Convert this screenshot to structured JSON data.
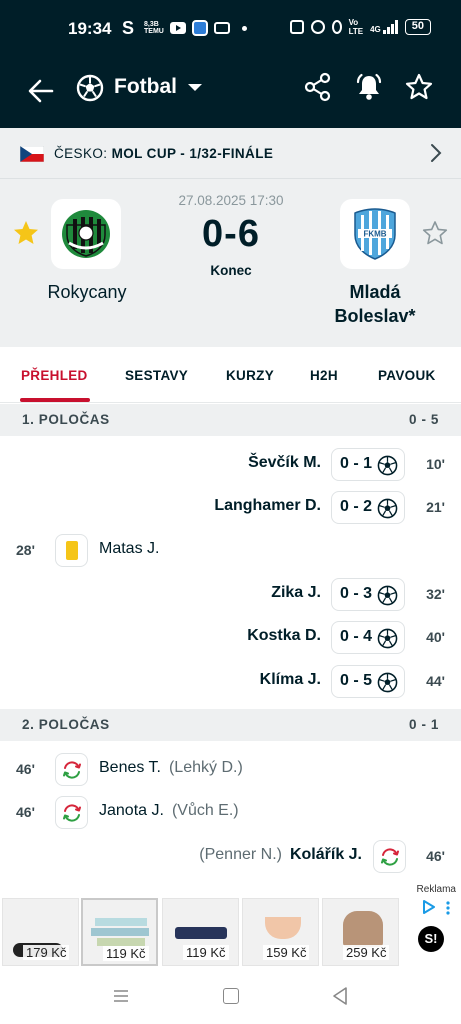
{
  "status_bar": {
    "time": "19:34",
    "carrier_glyph": "S",
    "mini_text_top": "8,3B",
    "mini_text_bottom": "TEMU",
    "network_label_1": "Vo",
    "network_label_1b": "LTE",
    "network_label_2": "4G",
    "battery": "50"
  },
  "toolbar": {
    "title": "Fotbal",
    "back_icon": "arrow-left-icon",
    "sport_icon": "soccer-ball-icon",
    "share_icon": "share-icon",
    "bell_icon": "bell-icon",
    "star_icon": "star-outline-icon"
  },
  "league": {
    "country": "ČESKO:",
    "competition": "MOL CUP - 1/32-FINÁLE"
  },
  "match": {
    "date": "27.08.2025 17:30",
    "score": "0-6",
    "status": "Konec",
    "home_team": "Rokycany",
    "away_team_line1": "Mladá",
    "away_team_line2": "Boleslav*",
    "home_favorite": true,
    "away_favorite": false,
    "colors": {
      "favorite_star": "#f5c518",
      "accent": "#c8102e",
      "dark": "#001e28"
    }
  },
  "tabs": [
    {
      "label": "PŘEHLED",
      "active": true
    },
    {
      "label": "SESTAVY",
      "active": false
    },
    {
      "label": "KURZY",
      "active": false
    },
    {
      "label": "H2H",
      "active": false
    },
    {
      "label": "PAVOUK",
      "active": false
    }
  ],
  "periods": [
    {
      "name": "1. POLOČAS",
      "score": "0 - 5",
      "events": [
        {
          "side": "away",
          "type": "goal",
          "minute": "10'",
          "player": "Ševčík M.",
          "score": "0 - 1"
        },
        {
          "side": "away",
          "type": "goal",
          "minute": "21'",
          "player": "Langhamer D.",
          "score": "0 - 2"
        },
        {
          "side": "home",
          "type": "yellow-card",
          "minute": "28'",
          "player": "Matas J."
        },
        {
          "side": "away",
          "type": "goal",
          "minute": "32'",
          "player": "Zika J.",
          "score": "0 - 3"
        },
        {
          "side": "away",
          "type": "goal",
          "minute": "40'",
          "player": "Kostka D.",
          "score": "0 - 4"
        },
        {
          "side": "away",
          "type": "goal",
          "minute": "44'",
          "player": "Klíma J.",
          "score": "0 - 5"
        }
      ]
    },
    {
      "name": "2. POLOČAS",
      "score": "0 - 1",
      "events": [
        {
          "side": "home",
          "type": "substitution",
          "minute": "46'",
          "player": "Benes T.",
          "assist": "(Lehký D.)"
        },
        {
          "side": "home",
          "type": "substitution",
          "minute": "46'",
          "player": "Janota J.",
          "assist": "(Vůch E.)"
        },
        {
          "side": "away",
          "type": "substitution",
          "minute": "46'",
          "player": "Kolářík J.",
          "assist": "(Penner N.)"
        }
      ]
    }
  ],
  "ad": {
    "label": "Reklama",
    "badge": "S!",
    "items": [
      {
        "price": "179 Kč"
      },
      {
        "price": "119 Kč"
      },
      {
        "price": "119 Kč"
      },
      {
        "price": "159 Kč"
      },
      {
        "price": "259 Kč"
      }
    ]
  }
}
